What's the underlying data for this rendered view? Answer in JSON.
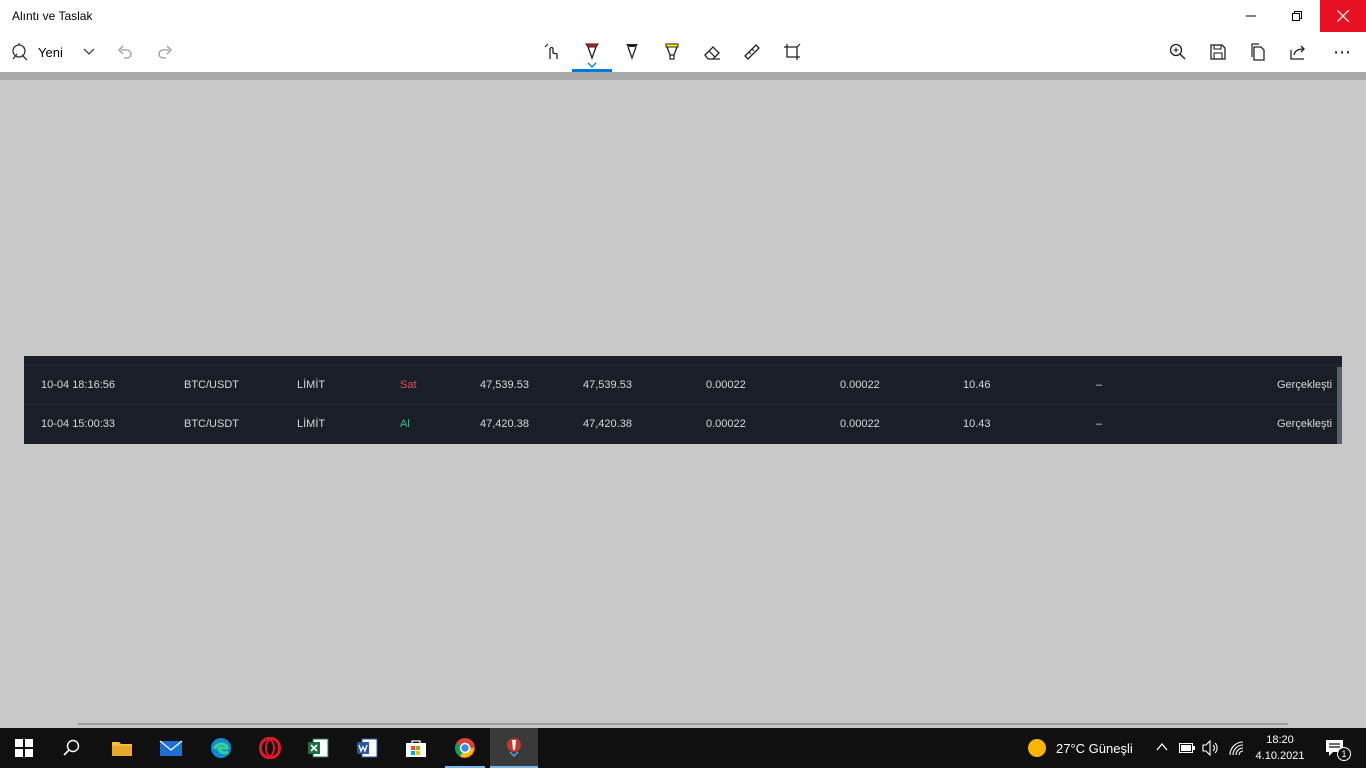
{
  "window": {
    "title": "Alıntı ve Taslak"
  },
  "toolbar": {
    "new_label": "Yeni",
    "icons": [
      "new-snip-icon",
      "chevron-down-icon",
      "undo-icon",
      "redo-icon",
      "touch-writing-icon",
      "ballpoint-pen-icon",
      "pencil-icon",
      "highlighter-icon",
      "eraser-icon",
      "ruler-icon",
      "crop-icon",
      "zoom-icon",
      "save-icon",
      "copy-icon",
      "share-icon",
      "more-icon"
    ],
    "pen_color": "#e81123",
    "highlighter_color": "#ffff00",
    "more_label": "⋯"
  },
  "orders": {
    "rows": [
      {
        "time": "10-04 18:16:56",
        "pair": "BTC/USDT",
        "type": "LİMİT",
        "side": "Sat",
        "price": "47,539.53",
        "avg_price": "47,539.53",
        "amount": "0.00022",
        "filled": "0.00022",
        "total": "10.46",
        "trigger": "–",
        "status": "Gerçekleşti"
      },
      {
        "time": "10-04 15:00:33",
        "pair": "BTC/USDT",
        "type": "LİMİT",
        "side": "Al",
        "price": "47,420.38",
        "avg_price": "47,420.38",
        "amount": "0.00022",
        "filled": "0.00022",
        "total": "10.43",
        "trigger": "–",
        "status": "Gerçekleşti"
      }
    ],
    "colors": {
      "sell": "#e05263",
      "buy": "#2ebd85",
      "background": "#1a1e26"
    }
  },
  "taskbar": {
    "apps": [
      "windows-start-icon",
      "search-icon",
      "file-explorer-icon",
      "mail-icon",
      "edge-icon",
      "opera-icon",
      "excel-icon",
      "word-icon",
      "store-icon",
      "chrome-icon",
      "snip-sketch-icon"
    ],
    "weather": "27°C  Güneşli",
    "time": "18:20",
    "date": "4.10.2021",
    "notifications": "1"
  }
}
